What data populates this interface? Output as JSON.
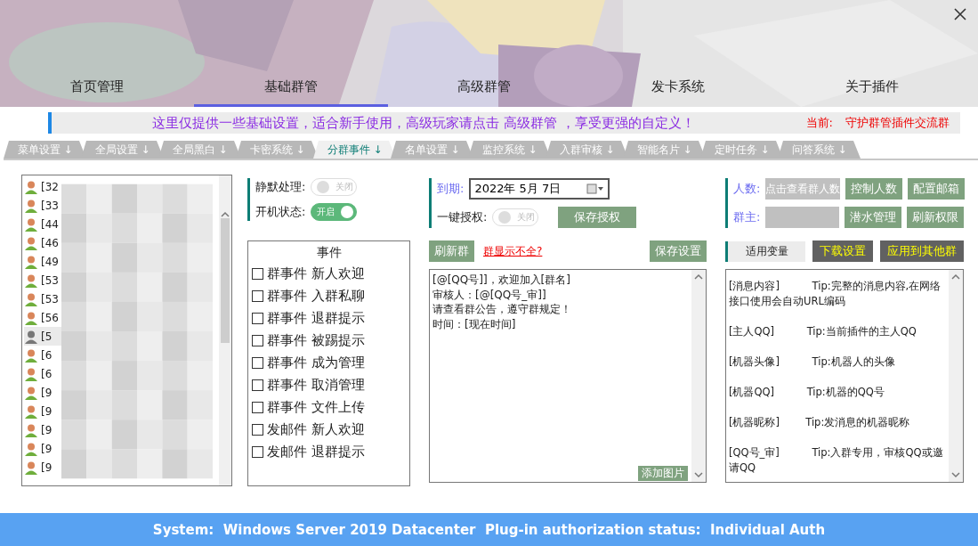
{
  "nav": [
    {
      "label": "首页管理",
      "selected": false
    },
    {
      "label": "基础群管",
      "selected": true
    },
    {
      "label": "高级群管",
      "selected": false
    },
    {
      "label": "发卡系统",
      "selected": false
    },
    {
      "label": "关于插件",
      "selected": false
    }
  ],
  "notice": {
    "text": "这里仅提供一些基础设置，适合新手使用，高级玩家请点击 高级群管 ，享受更强的自定义！",
    "current_label": "当前:",
    "current_group": "守护群管插件交流群"
  },
  "tabs": [
    {
      "label": "菜单设置 ↓",
      "selected": false
    },
    {
      "label": "全局设置 ↓",
      "selected": false
    },
    {
      "label": "全局黑白 ↓",
      "selected": false
    },
    {
      "label": "卡密系统 ↓",
      "selected": false
    },
    {
      "label": "分群事件 ↓",
      "selected": true
    },
    {
      "label": "名单设置 ↓",
      "selected": false
    },
    {
      "label": "监控系统 ↓",
      "selected": false
    },
    {
      "label": "入群审核 ↓",
      "selected": false
    },
    {
      "label": "智能名片 ↓",
      "selected": false
    },
    {
      "label": "定时任务 ↓",
      "selected": false
    },
    {
      "label": "问答系统 ↓",
      "selected": false
    }
  ],
  "group_list": [
    {
      "text": "[32",
      "selected": false
    },
    {
      "text": "[33",
      "selected": false
    },
    {
      "text": "[44",
      "selected": false
    },
    {
      "text": "[46",
      "selected": false
    },
    {
      "text": "[49",
      "selected": false
    },
    {
      "text": "[53",
      "selected": false
    },
    {
      "text": "[53",
      "selected": false
    },
    {
      "text": "[56",
      "selected": false
    },
    {
      "text": "[5",
      "selected": true
    },
    {
      "text": "[6",
      "selected": false
    },
    {
      "text": "[6",
      "selected": false
    },
    {
      "text": "[9",
      "selected": false
    },
    {
      "text": "[9",
      "selected": false
    },
    {
      "text": "[9",
      "selected": false
    },
    {
      "text": "[9",
      "selected": false
    },
    {
      "text": "[9",
      "selected": false
    }
  ],
  "switches": [
    {
      "label": "静默处理:",
      "on": false,
      "state_text": "关闭"
    },
    {
      "label": "开机状态:",
      "on": true,
      "state_text": "开启"
    }
  ],
  "auth": {
    "expiry_label": "到期:",
    "date": "2022年  5月  7日",
    "one_key": {
      "label": "一键授权:",
      "on": false,
      "state_text": "关闭"
    },
    "save_button": "保存授权"
  },
  "members": {
    "count_label": "人数:",
    "count_button": "点击查看群人数",
    "owner_label": "群主:",
    "buttons": [
      "控制人数",
      "配置邮箱",
      "潜水管理",
      "刷新权限"
    ]
  },
  "events": {
    "title": "事件",
    "items": [
      {
        "label": "群事件 新人欢迎",
        "checked": false
      },
      {
        "label": "群事件 入群私聊",
        "checked": false
      },
      {
        "label": "群事件 退群提示",
        "checked": false
      },
      {
        "label": "群事件 被踢提示",
        "checked": false
      },
      {
        "label": "群事件 成为管理",
        "checked": false
      },
      {
        "label": "群事件 取消管理",
        "checked": false
      },
      {
        "label": "群事件 文件上传",
        "checked": false
      },
      {
        "label": "发邮件 新人欢迎",
        "checked": false
      },
      {
        "label": "发邮件 退群提示",
        "checked": false
      }
    ]
  },
  "editor": {
    "refresh_button": "刷新群",
    "link": "群显示不全?",
    "save_button": "保存设置",
    "lines": [
      "[@[QQ号]]，欢迎加入[群名]",
      "审核人：[@[QQ号_审]]",
      "请查看群公告，遵守群规定！",
      "时间：[现在时间]"
    ],
    "add_image_button": "添加图片"
  },
  "variables": {
    "title": "适用变量",
    "download_button": "下载设置",
    "apply_button": "应用到其他群",
    "items": [
      "[消息内容]          Tip:完整的消息内容,在网络接口使用会自动URL编码",
      "[主人QQ]          Tip:当前插件的主人QQ",
      "[机器头像]          Tip:机器人的头像",
      "[机器QQ]          Tip:机器的QQ号",
      "[机器昵称]        Tip:发消息的机器昵称",
      "[QQ号_审]          Tip:入群专用，审核QQ或邀请QQ"
    ]
  },
  "status_bar": "System:  Windows Server 2019 Datacenter  Plug-in authorization status:  Individual Auth"
}
